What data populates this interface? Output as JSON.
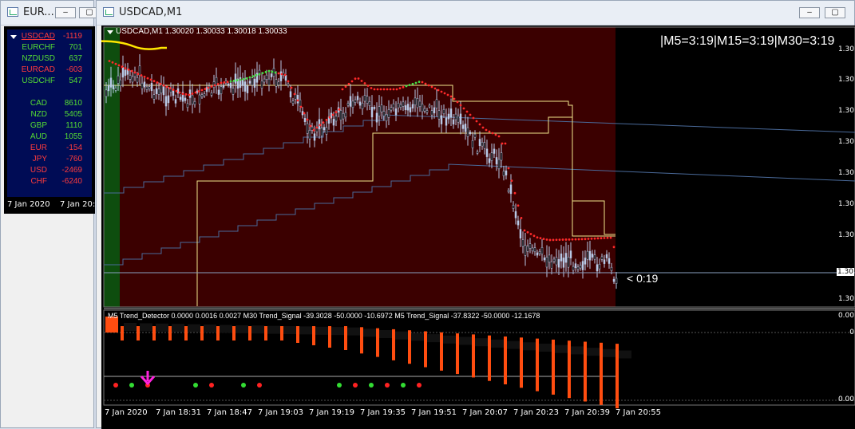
{
  "left_window": {
    "title": "EUR...",
    "min_label": "–",
    "max_label": "▢",
    "currency_rows": [
      {
        "pair": "USDCAD",
        "value": "-1119",
        "color": "#ff3b3b"
      },
      {
        "pair": "EURCHF",
        "value": "701",
        "color": "#55dd33"
      },
      {
        "pair": "NZDUSD",
        "value": "637",
        "color": "#55dd33"
      },
      {
        "pair": "EURCAD",
        "value": "-603",
        "color": "#ff3b3b"
      },
      {
        "pair": "USDCHF",
        "value": "547",
        "color": "#55dd33"
      }
    ],
    "strength_rows": [
      {
        "ccy": "CAD",
        "value": "8610",
        "color": "#55dd33"
      },
      {
        "ccy": "NZD",
        "value": "5405",
        "color": "#55dd33"
      },
      {
        "ccy": "GBP",
        "value": "1110",
        "color": "#55dd33"
      },
      {
        "ccy": "AUD",
        "value": "1055",
        "color": "#55dd33"
      },
      {
        "ccy": "EUR",
        "value": "-154",
        "color": "#ff3b3b"
      },
      {
        "ccy": "JPY",
        "value": "-760",
        "color": "#ff3b3b"
      },
      {
        "ccy": "USD",
        "value": "-2469",
        "color": "#ff3b3b"
      },
      {
        "ccy": "CHF",
        "value": "-6240",
        "color": "#ff3b3b"
      }
    ],
    "time_labels": [
      "7 Jan 2020",
      "7 Jan 20:3"
    ]
  },
  "main_window": {
    "title": "USDCAD,M1",
    "min_label": "–",
    "max_label": "▢",
    "close_label": "✕",
    "chart_header": "USDCAD,M1  1.30020 1.30033 1.30018 1.30033",
    "mtf_text": "|M5=3:19|M15=3:19|M30=3:19",
    "countdown": "< 0:19",
    "price_labels": [
      "1.30",
      "1.30",
      "1.30",
      "1.30",
      "1.30",
      "1.30",
      "1.30",
      "1.30",
      "1.30",
      "1.30"
    ],
    "current_price_label": "1.30",
    "indicator_header": "M5 Trend_Detector 0.0000 0.0016 0.0027  M30 Trend_Signal -39.3028 -50.0000 -10.6972  M5 Trend_Signal -37.8322 -50.0000 -12.1678",
    "indicator_scale": [
      "0.00",
      "0",
      "0.00"
    ],
    "time_labels": [
      "7 Jan 2020",
      "7 Jan 18:31",
      "7 Jan 18:47",
      "7 Jan 19:03",
      "7 Jan 19:19",
      "7 Jan 19:35",
      "7 Jan 19:51",
      "7 Jan 20:07",
      "7 Jan 20:23",
      "7 Jan 20:39",
      "7 Jan 20:55"
    ]
  },
  "colors": {
    "chart_bg": "#3b0000",
    "green_zone": "#0e4d0e",
    "candle": "#b7c9e6",
    "sar_red": "#ff2a2a",
    "sar_green": "#44dd44",
    "yellow_line": "#f0e68c",
    "steel_line": "#4a6a9a",
    "hist_orange": "#ff4d10",
    "arrow_magenta": "#ff22dd"
  },
  "icons": {
    "window_icon": "chart-window-icon",
    "collapse_triangle": "triangle-down-icon",
    "signal_arrow": "arrow-down-icon"
  }
}
